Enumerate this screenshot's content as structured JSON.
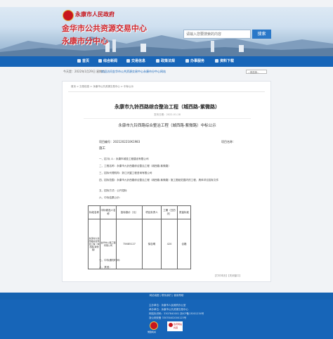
{
  "header": {
    "gov_name": "永康市人民政府",
    "title": "金华市公共资源交易中心",
    "subtitle": "永康市分中心",
    "search_placeholder": "请输入您要搜索的内容",
    "search_button": "搜索"
  },
  "nav": {
    "items": [
      {
        "label": "首页"
      },
      {
        "label": "综合新闻"
      },
      {
        "label": "交易信息"
      },
      {
        "label": "政策法规"
      },
      {
        "label": "办事服务"
      },
      {
        "label": "资料下载"
      }
    ]
  },
  "subbar": {
    "date": "今天是：2022年1月29日 星期六",
    "notice": "欢迎访问金华市公共资源交易中心永康市分中心网站",
    "select_value": "--请选择--"
  },
  "breadcrumb": "首页 > 交易信息 > 永康市公共资源交易中心 > 中标公示",
  "doc": {
    "title": "永康市九铃西路综合整治工程（城西路-紫微路）",
    "meta": "发布日期：2022-01-28",
    "heading": "永康市九铃西路综合整治工程（城西路-紫微路）中标公示",
    "project_no_label": "项目编号：2021202210K1983",
    "section_label": "项目名称：",
    "section": "施工",
    "lines": [
      "一、招 标 人：永康市城投工程建设有限公司",
      "二、工程名称：永康市九铃西路综合整治工程（城西路-紫微路）",
      "三、招标代理机构：浙江天翼工程咨询有限公司",
      "四、招标范围：永康市九铃西路综合整治工程（城西路-紫微路）施工图纸范围内的工程，具体详见招标文件",
      "五、招标方式：公开招标",
      "六、中标结果公示："
    ],
    "table": {
      "headers": [
        "标段名称",
        "中标候选人名称",
        "投标报价（元）",
        "项目负责人",
        "工期（日历天）",
        "质量标准"
      ],
      "row": [
        "永康市九铃西路综合整治工程（城西路-紫微路）",
        "金华市公路工程有限公司",
        "75685127",
        "徐自明",
        "420",
        "合格"
      ]
    },
    "after_lines": [
      "七、中标通知时间：",
      "八、其他："
    ]
  },
  "pager": {
    "prev": "【打印本页】",
    "next": "【关闭窗口】"
  },
  "footer": {
    "links": "网站地图 | 联系我们 | 使用帮助",
    "info": [
      "主办单位：永康市人民政府办公室",
      "承办单位：永康市公共资源交易中心",
      "网站标识码：3307840001  浙ICP备13001234号",
      "浙公网安备 33078402000123号"
    ],
    "badge": "党政机关",
    "error_1": "政府网站",
    "error_2": "找错"
  }
}
